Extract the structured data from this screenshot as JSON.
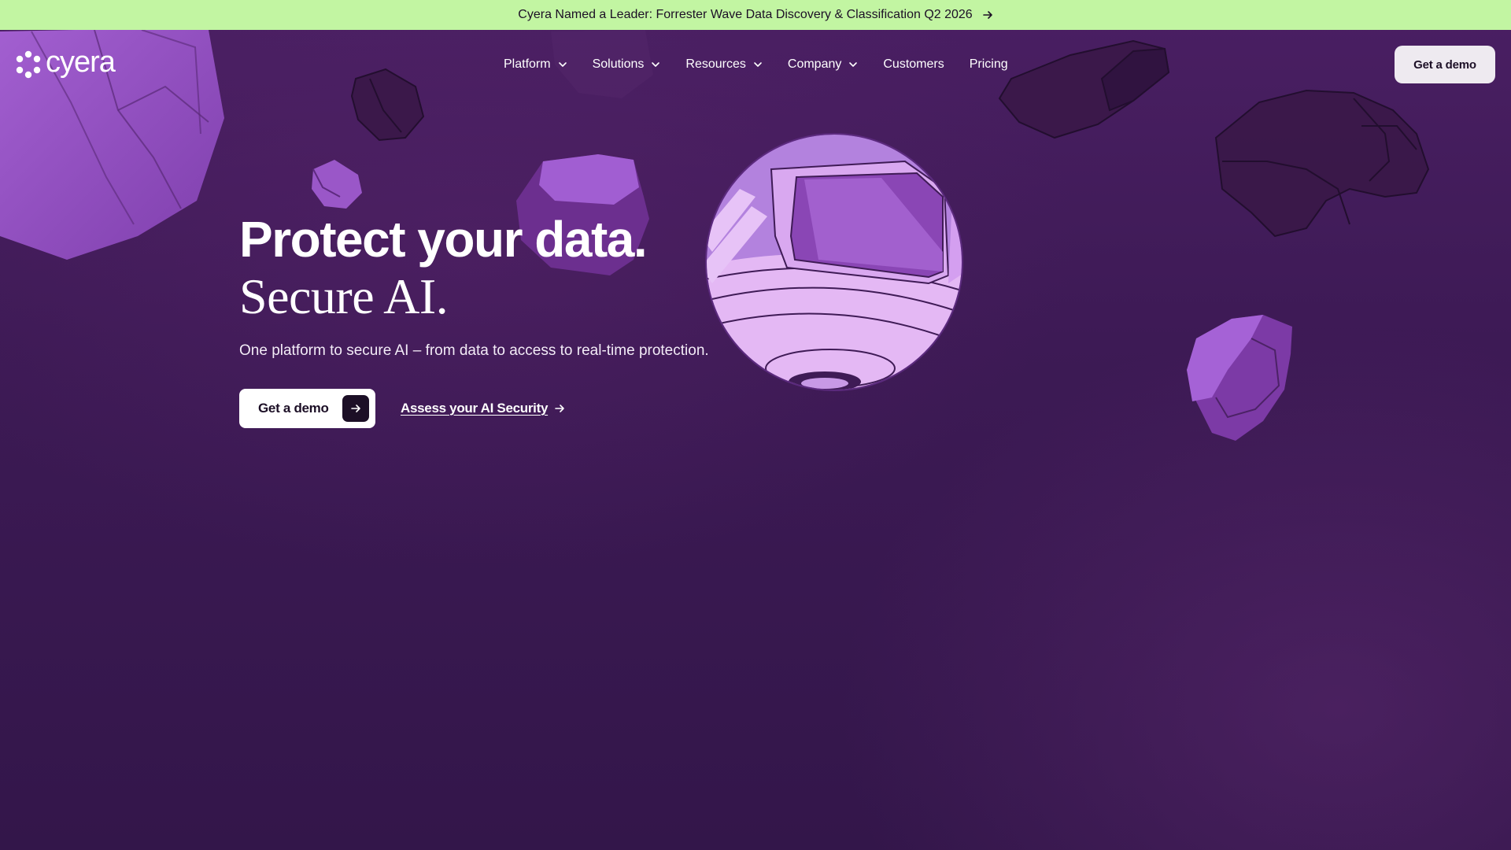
{
  "banner": {
    "text": "Cyera Named a Leader: Forrester Wave Data Discovery & Classification Q2 2026",
    "arrow_icon": "arrow-right-icon",
    "background": "#c2f5a2"
  },
  "header": {
    "logo_text": "cyera",
    "nav": [
      {
        "label": "Platform",
        "has_dropdown": true
      },
      {
        "label": "Solutions",
        "has_dropdown": true
      },
      {
        "label": "Resources",
        "has_dropdown": true
      },
      {
        "label": "Company",
        "has_dropdown": true
      },
      {
        "label": "Customers",
        "has_dropdown": false
      },
      {
        "label": "Pricing",
        "has_dropdown": false
      }
    ],
    "cta_label": "Get a demo"
  },
  "hero": {
    "title": "Protect your data.",
    "subtitle": "Secure AI.",
    "description": "One platform to secure AI – from data to access to real-time protection.",
    "primary_cta": "Get a demo",
    "secondary_cta": "Assess your AI Security"
  },
  "colors": {
    "background": "#3d1a55",
    "accent_purple": "#9b5bc7",
    "banner_green": "#c2f5a2",
    "text_dark": "#1c0f26"
  }
}
